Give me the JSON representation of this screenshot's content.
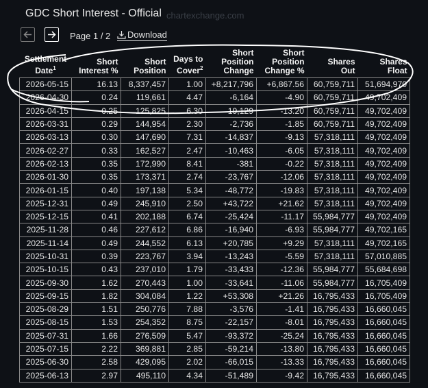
{
  "header": {
    "title": "GDC Short Interest - Official",
    "brand": "chartexchange.com"
  },
  "pager": {
    "page_label": "Page 1 / 2",
    "download_label": "Download"
  },
  "table": {
    "columns": [
      {
        "line1": "Settlement",
        "line2": "Date",
        "sup": "1"
      },
      {
        "line1": "Short",
        "line2": "Interest %",
        "sup": ""
      },
      {
        "line1": "Short",
        "line2": "Position",
        "sup": ""
      },
      {
        "line1": "Days to",
        "line2": "Cover",
        "sup": "2"
      },
      {
        "line0": "Short",
        "line1": "Position",
        "line2": "Change",
        "sup": ""
      },
      {
        "line0": "Short",
        "line1": "Position",
        "line2": "Change %",
        "sup": ""
      },
      {
        "line1": "Shares",
        "line2": "Out",
        "sup": ""
      },
      {
        "line1": "Shares",
        "line2": "Float",
        "sup": ""
      }
    ],
    "rows": [
      [
        "2026-05-15",
        "16.13",
        "8,337,457",
        "1.00",
        "+8,217,796",
        "+6,867.56",
        "60,759,711",
        "51,694,970"
      ],
      [
        "2026-04-30",
        "0.24",
        "119,661",
        "4.47",
        "-6,164",
        "-4.90",
        "60,759,711",
        "49,702,409"
      ],
      [
        "2026-04-15",
        "0.25",
        "125,825",
        "6.30",
        "-19,129",
        "-13.20",
        "60,759,711",
        "49,702,409"
      ],
      [
        "2026-03-31",
        "0.29",
        "144,954",
        "2.30",
        "-2,736",
        "-1.85",
        "60,759,711",
        "49,702,409"
      ],
      [
        "2026-03-13",
        "0.30",
        "147,690",
        "7.31",
        "-14,837",
        "-9.13",
        "57,318,111",
        "49,702,409"
      ],
      [
        "2026-02-27",
        "0.33",
        "162,527",
        "2.47",
        "-10,463",
        "-6.05",
        "57,318,111",
        "49,702,409"
      ],
      [
        "2026-02-13",
        "0.35",
        "172,990",
        "8.41",
        "-381",
        "-0.22",
        "57,318,111",
        "49,702,409"
      ],
      [
        "2026-01-30",
        "0.35",
        "173,371",
        "2.74",
        "-23,767",
        "-12.06",
        "57,318,111",
        "49,702,409"
      ],
      [
        "2026-01-15",
        "0.40",
        "197,138",
        "5.34",
        "-48,772",
        "-19.83",
        "57,318,111",
        "49,702,409"
      ],
      [
        "2025-12-31",
        "0.49",
        "245,910",
        "2.50",
        "+43,722",
        "+21.62",
        "57,318,111",
        "49,702,409"
      ],
      [
        "2025-12-15",
        "0.41",
        "202,188",
        "6.74",
        "-25,424",
        "-11.17",
        "55,984,777",
        "49,702,409"
      ],
      [
        "2025-11-28",
        "0.46",
        "227,612",
        "6.86",
        "-16,940",
        "-6.93",
        "55,984,777",
        "49,702,165"
      ],
      [
        "2025-11-14",
        "0.49",
        "244,552",
        "6.13",
        "+20,785",
        "+9.29",
        "57,318,111",
        "49,702,165"
      ],
      [
        "2025-10-31",
        "0.39",
        "223,767",
        "3.94",
        "-13,243",
        "-5.59",
        "57,318,111",
        "57,010,885"
      ],
      [
        "2025-10-15",
        "0.43",
        "237,010",
        "1.79",
        "-33,433",
        "-12.36",
        "55,984,777",
        "55,684,698"
      ],
      [
        "2025-09-30",
        "1.62",
        "270,443",
        "1.00",
        "-33,641",
        "-11.06",
        "55,984,777",
        "16,705,409"
      ],
      [
        "2025-09-15",
        "1.82",
        "304,084",
        "1.22",
        "+53,308",
        "+21.26",
        "16,795,433",
        "16,705,409"
      ],
      [
        "2025-08-29",
        "1.51",
        "250,776",
        "7.88",
        "-3,576",
        "-1.41",
        "16,795,433",
        "16,660,045"
      ],
      [
        "2025-08-15",
        "1.53",
        "254,352",
        "8.75",
        "-22,157",
        "-8.01",
        "16,795,433",
        "16,660,045"
      ],
      [
        "2025-07-31",
        "1.66",
        "276,509",
        "5.47",
        "-93,372",
        "-25.24",
        "16,795,433",
        "16,660,045"
      ],
      [
        "2025-07-15",
        "2.22",
        "369,881",
        "2.85",
        "-59,214",
        "-13.80",
        "16,795,433",
        "16,660,045"
      ],
      [
        "2025-06-30",
        "2.58",
        "429,095",
        "2.02",
        "-66,015",
        "-13.33",
        "16,795,433",
        "16,660,045"
      ],
      [
        "2025-06-13",
        "2.97",
        "495,110",
        "4.34",
        "-51,489",
        "-9.42",
        "16,795,433",
        "16,660,045"
      ]
    ]
  },
  "colors": {
    "background": "#0e1116",
    "annotation": "#ffffff"
  }
}
